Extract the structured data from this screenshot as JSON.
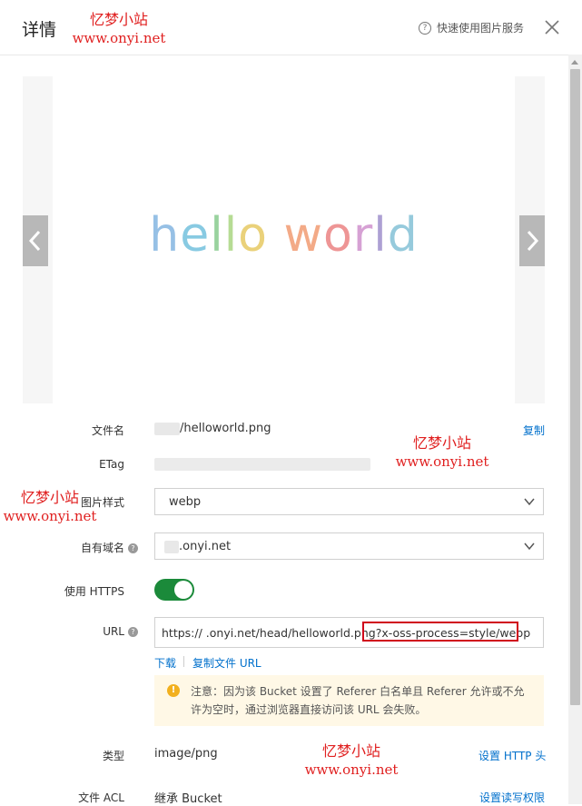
{
  "header": {
    "title": "详情",
    "help_link": "快速使用图片服务",
    "help_icon": "question-circle-icon",
    "close_icon": "close-icon"
  },
  "watermark": {
    "cn": "忆梦小站",
    "url": "www.onyi.net",
    "color": "#e02020"
  },
  "preview": {
    "image_text": "hello world",
    "letters": [
      {
        "ch": "h",
        "color": "#6fa8dc"
      },
      {
        "ch": "e",
        "color": "#5bb6d8"
      },
      {
        "ch": "l",
        "color": "#72c27a"
      },
      {
        "ch": "l",
        "color": "#9bcf6b"
      },
      {
        "ch": "o",
        "color": "#e2c047"
      },
      {
        "ch": " ",
        "color": "#ffffff"
      },
      {
        "ch": "w",
        "color": "#ef8a5a"
      },
      {
        "ch": "o",
        "color": "#e86d6d"
      },
      {
        "ch": "r",
        "color": "#c77dc4"
      },
      {
        "ch": "l",
        "color": "#8e7cc3"
      },
      {
        "ch": "d",
        "color": "#6fb7cf"
      }
    ],
    "prev_icon": "chevron-left-icon",
    "next_icon": "chevron-right-icon"
  },
  "details": {
    "filename_label": "文件名",
    "filename_value": "/helloworld.png",
    "copy_label": "复制",
    "etag_label": "ETag",
    "style_label": "图片样式",
    "style_value": "webp",
    "domain_label": "自有域名",
    "domain_value": ".onyi.net",
    "https_label": "使用 HTTPS",
    "https_enabled": true,
    "url_label": "URL",
    "url_value": "https://  .onyi.net/head/helloworld.png?x-oss-process=style/webp",
    "download_label": "下载",
    "copy_url_label": "复制文件 URL",
    "notice": "注意：因为该 Bucket 设置了 Referer 白名单且 Referer 允许或不允许为空时，通过浏览器直接访问该 URL 会失败。",
    "type_label": "类型",
    "type_value": "image/png",
    "set_http_header": "设置 HTTP 头",
    "acl_label": "文件 ACL",
    "acl_value": "继承 Bucket",
    "set_acl": "设置读写权限"
  },
  "colors": {
    "link": "#0070cc",
    "toggle_on": "#1b8a3a",
    "notice_bg": "#fff8e6",
    "warning": "#f2b01e",
    "highlight_border": "#d0021b"
  }
}
